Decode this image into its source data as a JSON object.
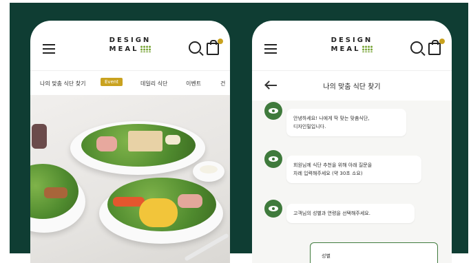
{
  "left_screen": {
    "logo_line1": "DESIGN",
    "logo_line2": "MEAL",
    "nav": {
      "item1": "나의 맞춤 식단 찾기",
      "event_badge": "Event",
      "item2": "데일리 식단",
      "item3": "이벤트",
      "item4": "건"
    }
  },
  "right_screen": {
    "logo_line1": "DESIGN",
    "logo_line2": "MEAL",
    "title": "나의 맞춤 식단 찾기",
    "messages": [
      "안녕하세요! 나에게 딱 맞는 맞춤식단,\n디자인밀입니다.",
      "회원님께 식단 추천을 위해 아래 질문을\n차례 입력해주세요 (약 30초 소요)",
      "고객님의 성별과 연령을 선택해주세요."
    ],
    "answer_label": "성별"
  },
  "colors": {
    "background": "#0f3d33",
    "accent_gold": "#c9a21f",
    "brand_green": "#3f7a3c",
    "logo_dots": "#7aa63a"
  },
  "icons": [
    "menu-icon",
    "search-icon",
    "bag-icon",
    "back-icon",
    "eye-icon"
  ]
}
